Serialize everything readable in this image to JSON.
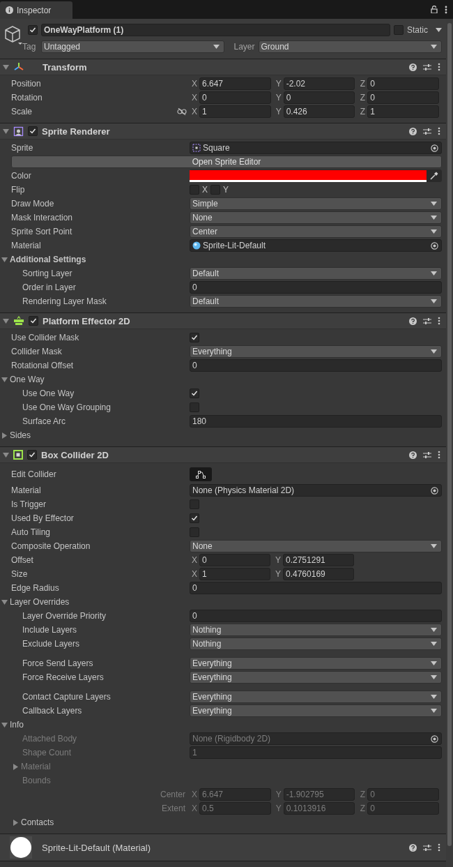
{
  "tab": {
    "title": "Inspector"
  },
  "object": {
    "active": true,
    "name": "OneWayPlatform (1)",
    "static": false,
    "static_label": "Static",
    "tag_label": "Tag",
    "tag": "Untagged",
    "layer_label": "Layer",
    "layer": "Ground"
  },
  "components": [
    {
      "kind": "transform",
      "title": "Transform",
      "expanded": true,
      "rows": [
        {
          "kind": "vector",
          "label": "Position",
          "axes": [
            {
              "axis": "X",
              "value": "6.647"
            },
            {
              "axis": "Y",
              "value": "-2.02"
            },
            {
              "axis": "Z",
              "value": "0"
            }
          ]
        },
        {
          "kind": "vector",
          "label": "Rotation",
          "axes": [
            {
              "axis": "X",
              "value": "0"
            },
            {
              "axis": "Y",
              "value": "0"
            },
            {
              "axis": "Z",
              "value": "0"
            }
          ]
        },
        {
          "kind": "vector",
          "label": "Scale",
          "constrained": false,
          "axes": [
            {
              "axis": "X",
              "value": "1"
            },
            {
              "axis": "Y",
              "value": "0.426"
            },
            {
              "axis": "Z",
              "value": "1"
            }
          ]
        }
      ]
    },
    {
      "kind": "sprite-renderer",
      "title": "Sprite Renderer",
      "enabled": true,
      "expanded": true,
      "rows": [
        {
          "kind": "sprite-object",
          "label": "Sprite",
          "value": "Square"
        },
        {
          "kind": "button",
          "label": "Open Sprite Editor"
        },
        {
          "kind": "color",
          "label": "Color",
          "color": "#ff0000"
        },
        {
          "kind": "flip",
          "label": "Flip",
          "toggles": [
            {
              "axis": "X",
              "checked": false
            },
            {
              "axis": "Y",
              "checked": false
            }
          ]
        },
        {
          "kind": "dropdown",
          "label": "Draw Mode",
          "value": "Simple"
        },
        {
          "kind": "dropdown",
          "label": "Mask Interaction",
          "value": "None"
        },
        {
          "kind": "dropdown",
          "label": "Sprite Sort Point",
          "value": "Center"
        },
        {
          "kind": "material-object",
          "label": "Material",
          "value": "Sprite-Lit-Default"
        },
        {
          "kind": "foldout",
          "label": "Additional Settings",
          "bold": true,
          "expanded": true,
          "children": [
            {
              "kind": "dropdown",
              "label": "Sorting Layer",
              "value": "Default"
            },
            {
              "kind": "number",
              "label": "Order in Layer",
              "value": "0"
            },
            {
              "kind": "dropdown",
              "label": "Rendering Layer Mask",
              "value": "Default"
            }
          ]
        }
      ]
    },
    {
      "kind": "platform-effector",
      "title": "Platform Effector 2D",
      "enabled": true,
      "expanded": true,
      "rows": [
        {
          "kind": "checkbox",
          "label": "Use Collider Mask",
          "checked": true
        },
        {
          "kind": "dropdown",
          "label": "Collider Mask",
          "value": "Everything"
        },
        {
          "kind": "number",
          "label": "Rotational Offset",
          "value": "0"
        },
        {
          "kind": "foldout",
          "label": "One Way",
          "expanded": true,
          "children": [
            {
              "kind": "checkbox",
              "label": "Use One Way",
              "checked": true
            },
            {
              "kind": "checkbox",
              "label": "Use One Way Grouping",
              "checked": false
            },
            {
              "kind": "number",
              "label": "Surface Arc",
              "value": "180"
            }
          ]
        },
        {
          "kind": "foldout",
          "label": "Sides",
          "expanded": false
        }
      ]
    },
    {
      "kind": "box-collider",
      "title": "Box Collider 2D",
      "enabled": true,
      "expanded": true,
      "rows": [
        {
          "kind": "edit",
          "label": "Edit Collider"
        },
        {
          "kind": "object",
          "label": "Material",
          "value": "None (Physics Material 2D)"
        },
        {
          "kind": "checkbox",
          "label": "Is Trigger",
          "checked": false
        },
        {
          "kind": "checkbox",
          "label": "Used By Effector",
          "checked": true
        },
        {
          "kind": "checkbox",
          "label": "Auto Tiling",
          "checked": false
        },
        {
          "kind": "dropdown",
          "label": "Composite Operation",
          "value": "None"
        },
        {
          "kind": "vector",
          "label": "Offset",
          "axes": [
            {
              "axis": "X",
              "value": "0"
            },
            {
              "axis": "Y",
              "value": "0.2751291"
            }
          ]
        },
        {
          "kind": "vector",
          "label": "Size",
          "axes": [
            {
              "axis": "X",
              "value": "1"
            },
            {
              "axis": "Y",
              "value": "0.4760169"
            }
          ]
        },
        {
          "kind": "number",
          "label": "Edge Radius",
          "value": "0"
        },
        {
          "kind": "foldout",
          "label": "Layer Overrides",
          "expanded": true,
          "children": [
            {
              "kind": "number",
              "label": "Layer Override Priority",
              "value": "0"
            },
            {
              "kind": "dropdown",
              "label": "Include Layers",
              "value": "Nothing"
            },
            {
              "kind": "dropdown",
              "label": "Exclude Layers",
              "value": "Nothing"
            },
            {
              "kind": "spacer"
            },
            {
              "kind": "dropdown",
              "label": "Force Send Layers",
              "value": "Everything"
            },
            {
              "kind": "dropdown",
              "label": "Force Receive Layers",
              "value": "Everything"
            },
            {
              "kind": "spacer"
            },
            {
              "kind": "dropdown",
              "label": "Contact Capture Layers",
              "value": "Everything"
            },
            {
              "kind": "dropdown",
              "label": "Callback Layers",
              "value": "Everything"
            }
          ]
        },
        {
          "kind": "foldout",
          "label": "Info",
          "expanded": true,
          "children": [
            {
              "kind": "object",
              "label": "Attached Body",
              "value": "None (Rigidbody 2D)",
              "disabled": true
            },
            {
              "kind": "number",
              "label": "Shape Count",
              "value": "1",
              "disabled": true
            },
            {
              "kind": "foldout",
              "label": "Material",
              "expanded": false,
              "disabled": true
            },
            {
              "kind": "label",
              "label": "Bounds",
              "disabled": true
            },
            {
              "kind": "sub-vector",
              "label": "Center",
              "disabled": true,
              "axes": [
                {
                  "axis": "X",
                  "value": "6.647"
                },
                {
                  "axis": "Y",
                  "value": "-1.902795"
                },
                {
                  "axis": "Z",
                  "value": "0"
                }
              ]
            },
            {
              "kind": "sub-vector",
              "label": "Extent",
              "disabled": true,
              "axes": [
                {
                  "axis": "X",
                  "value": "0.5"
                },
                {
                  "axis": "Y",
                  "value": "0.1013916"
                },
                {
                  "axis": "Z",
                  "value": "0"
                }
              ]
            },
            {
              "kind": "foldout",
              "label": "Contacts",
              "expanded": false,
              "disabled": false
            }
          ]
        }
      ]
    },
    {
      "kind": "material",
      "title": "Sprite-Lit-Default (Material)",
      "expanded": false
    }
  ]
}
